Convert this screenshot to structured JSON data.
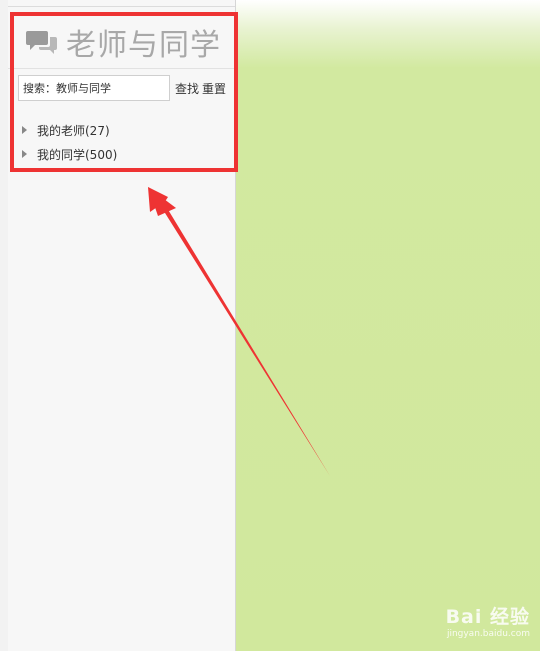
{
  "sidebar": {
    "title": "老师与同学",
    "search": {
      "value": "搜索：教师与同学",
      "find_label": "查找",
      "reset_label": "重置"
    },
    "groups": [
      {
        "label": "我的老师(27)"
      },
      {
        "label": "我的同学(500)"
      }
    ]
  },
  "watermark": {
    "main": "Bai 经验",
    "sub": "jingyan.baidu.com"
  },
  "colors": {
    "highlight": "#ee3333",
    "content_bg": "#d1e89d",
    "arrow": "#ee3333"
  },
  "icons": [
    "chat-bubbles-icon",
    "expand-triangle-icon"
  ]
}
